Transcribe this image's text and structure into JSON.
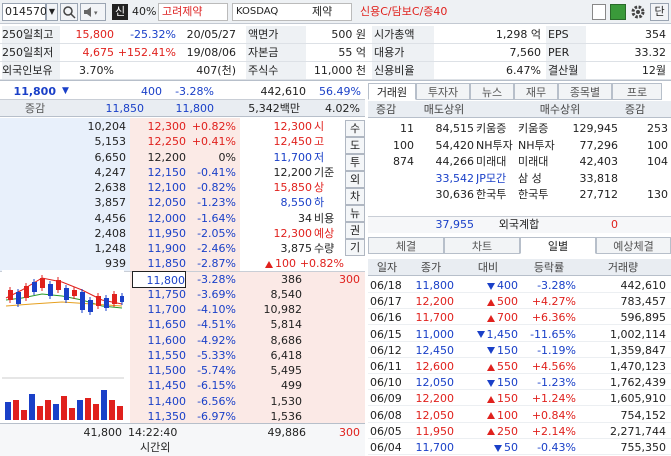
{
  "toolbar": {
    "code": "014570",
    "sin_label": "신",
    "margin": "40%",
    "name": "고려제약",
    "market": "KOSDAQ",
    "sector": "제약",
    "credit": "신용C/담보C/증40",
    "btn_dan": "단"
  },
  "info": {
    "rows": [
      {
        "l1": "250일최고",
        "v1": "15,800",
        "p1": "-25.32%",
        "d1": "20/05/27",
        "l2": "액면가",
        "v2": "500 원",
        "l3": "시가총액",
        "v3": "1,298 억",
        "l4": "EPS",
        "v4": "354"
      },
      {
        "l1": "250일최저",
        "v1": "4,675",
        "p1": "+152.41%",
        "d1": "19/08/06",
        "l2": "자본금",
        "v2": "55 억",
        "l3": "대용가",
        "v3": "7,560",
        "l4": "PER",
        "v4": "33.32"
      },
      {
        "l1": "외국인보유",
        "v1": "3.70%",
        "p1": "",
        "d1": "407(천)",
        "l2": "주식수",
        "v2": "11,000 천",
        "l3": "신용비율",
        "v3": "6.47%",
        "l4": "결산월",
        "v4": "12월"
      }
    ]
  },
  "quote": {
    "price": "11,800",
    "change": "400",
    "rate": "-3.28%",
    "volume": "442,610",
    "vol_ratio": "56.49%",
    "hdr_label": "증감",
    "hdr_a": "11,850",
    "hdr_b": "11,800",
    "hdr_c": "5,342백만",
    "hdr_d": "4.02%"
  },
  "asks": [
    {
      "qty": "10,204",
      "price": "12,300",
      "rate": "+0.82%"
    },
    {
      "qty": "5,153",
      "price": "12,250",
      "rate": "+0.41%"
    },
    {
      "qty": "6,650",
      "price": "12,200",
      "rate": "0%"
    },
    {
      "qty": "4,247",
      "price": "12,150",
      "rate": "-0.41%"
    },
    {
      "qty": "2,638",
      "price": "12,100",
      "rate": "-0.82%"
    },
    {
      "qty": "3,857",
      "price": "12,050",
      "rate": "-1.23%"
    },
    {
      "qty": "4,456",
      "price": "12,000",
      "rate": "-1.64%"
    },
    {
      "qty": "2,408",
      "price": "11,950",
      "rate": "-2.05%"
    },
    {
      "qty": "1,248",
      "price": "11,900",
      "rate": "-2.46%"
    },
    {
      "qty": "939",
      "price": "11,850",
      "rate": "-2.87%"
    }
  ],
  "bids": [
    {
      "qty": "386",
      "price": "11,800",
      "rate": "-3.28%"
    },
    {
      "qty": "8,540",
      "price": "11,750",
      "rate": "-3.69%"
    },
    {
      "qty": "10,982",
      "price": "11,700",
      "rate": "-4.10%"
    },
    {
      "qty": "5,814",
      "price": "11,650",
      "rate": "-4.51%"
    },
    {
      "qty": "8,686",
      "price": "11,600",
      "rate": "-4.92%"
    },
    {
      "qty": "6,418",
      "price": "11,550",
      "rate": "-5.33%"
    },
    {
      "qty": "5,495",
      "price": "11,500",
      "rate": "-5.74%"
    },
    {
      "qty": "499",
      "price": "11,450",
      "rate": "-6.15%"
    },
    {
      "qty": "1,530",
      "price": "11,400",
      "rate": "-6.56%"
    },
    {
      "qty": "1,536",
      "price": "11,350",
      "rate": "-6.97%"
    }
  ],
  "summary": [
    {
      "val": "12,300",
      "lbl": "시"
    },
    {
      "val": "12,450",
      "lbl": "고"
    },
    {
      "val": "11,700",
      "lbl": "저"
    },
    {
      "val": "12,200",
      "lbl": "기준"
    },
    {
      "val": "15,850",
      "lbl": "상"
    },
    {
      "val": "8,550",
      "lbl": "하"
    },
    {
      "val": "34",
      "lbl": "비용"
    },
    {
      "val": "12,300",
      "lbl": "예상"
    },
    {
      "val": "3,875",
      "lbl": "수량"
    }
  ],
  "summary_last": {
    "val": "100",
    "rate": "+0.82%"
  },
  "side_buttons": [
    "수",
    "도",
    "투",
    "외",
    "차",
    "뉴",
    "권",
    "기"
  ],
  "mini_right": "300",
  "bottom": {
    "ask_total": "41,800",
    "time": "14:22:40",
    "time_label": "시간외",
    "bid_total": "49,886",
    "right": "300"
  },
  "broker": {
    "tabs": [
      "거래원",
      "투자자",
      "뉴스",
      "재무",
      "종목별",
      "프로"
    ],
    "headers": [
      "증감",
      "매도상위",
      "매수상위",
      "증감"
    ],
    "rows": [
      {
        "d1": "11",
        "sq": "84,515",
        "sn": "키움증",
        "bn": "키움증",
        "bq": "129,945",
        "d2": "253"
      },
      {
        "d1": "100",
        "sq": "54,420",
        "sn": "NH투자",
        "bn": "NH투자",
        "bq": "77,296",
        "d2": "100"
      },
      {
        "d1": "874",
        "sq": "44,266",
        "sn": "미래대",
        "bn": "미래대",
        "bq": "42,403",
        "d2": "104"
      },
      {
        "d1": "",
        "sq": "33,542",
        "sn": "JP모간",
        "bn": "삼 성",
        "bq": "33,818",
        "d2": ""
      },
      {
        "d1": "",
        "sq": "30,636",
        "sn": "한국투",
        "bn": "한국투",
        "bq": "27,712",
        "d2": "130"
      }
    ],
    "foreign_q": "37,955",
    "foreign_label": "외국계합",
    "foreign_v": "0"
  },
  "daily": {
    "tabs": [
      "체결",
      "차트",
      "일별",
      "예상체결"
    ],
    "headers": [
      "일자",
      "종가",
      "대비",
      "등락률",
      "거래량"
    ],
    "rows": [
      {
        "date": "06/18",
        "close": "11,800",
        "dir": "dn",
        "chg": "400",
        "rate": "-3.28%",
        "vol": "442,610"
      },
      {
        "date": "06/17",
        "close": "12,200",
        "dir": "up",
        "chg": "500",
        "rate": "+4.27%",
        "vol": "783,457"
      },
      {
        "date": "06/16",
        "close": "11,700",
        "dir": "up",
        "chg": "700",
        "rate": "+6.36%",
        "vol": "596,895"
      },
      {
        "date": "06/15",
        "close": "11,000",
        "dir": "dn",
        "chg": "1,450",
        "rate": "-11.65%",
        "vol": "1,002,114"
      },
      {
        "date": "06/12",
        "close": "12,450",
        "dir": "dn",
        "chg": "150",
        "rate": "-1.19%",
        "vol": "1,359,847"
      },
      {
        "date": "06/11",
        "close": "12,600",
        "dir": "up",
        "chg": "550",
        "rate": "+4.56%",
        "vol": "1,470,123"
      },
      {
        "date": "06/10",
        "close": "12,050",
        "dir": "dn",
        "chg": "150",
        "rate": "-1.23%",
        "vol": "1,762,439"
      },
      {
        "date": "06/09",
        "close": "12,200",
        "dir": "up",
        "chg": "150",
        "rate": "+1.24%",
        "vol": "1,605,910"
      },
      {
        "date": "06/08",
        "close": "12,050",
        "dir": "up",
        "chg": "100",
        "rate": "+0.84%",
        "vol": "754,152"
      },
      {
        "date": "06/05",
        "close": "11,950",
        "dir": "up",
        "chg": "250",
        "rate": "+2.14%",
        "vol": "2,271,744"
      },
      {
        "date": "06/04",
        "close": "11,700",
        "dir": "dn",
        "chg": "50",
        "rate": "-0.43%",
        "vol": "755,350"
      }
    ]
  },
  "colors": {
    "up": "#e0211d",
    "down": "#1a40c8",
    "ask_bg": "#e8f0fb",
    "bid_bg": "#fbe9e6"
  }
}
